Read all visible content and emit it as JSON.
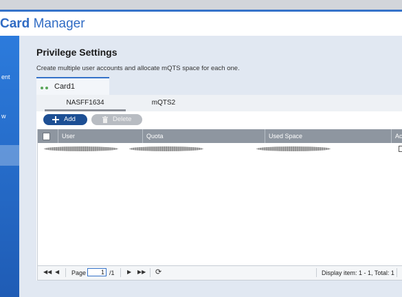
{
  "app": {
    "title_bold": "Card",
    "title_rest": " Manager"
  },
  "sidebar": {
    "items": [
      {
        "label": "ent"
      },
      {
        "label": "w"
      }
    ]
  },
  "main": {
    "title": "Privilege Settings",
    "description": "Create multiple user accounts and allocate mQTS space for each one.",
    "card_tab": "Card1",
    "subtabs": [
      {
        "label": "NASFF1634",
        "active": true
      },
      {
        "label": "mQTS2",
        "active": false
      }
    ],
    "toolbar": {
      "add_label": "Add",
      "delete_label": "Delete"
    },
    "table": {
      "columns": [
        "User",
        "Quota",
        "Used Space",
        "Ac"
      ],
      "rows_count_note": 1
    },
    "pager": {
      "page_label": "Page",
      "page_value": "1",
      "page_total": "/1",
      "display_text": "Display item: 1 - 1, Total: 1"
    }
  },
  "colors": {
    "accent": "#3572c9",
    "add_button": "#1d4f94",
    "header": "#8e96a0"
  },
  "icons": [
    "plus-icon",
    "trash-icon",
    "first-page-icon",
    "prev-page-icon",
    "next-page-icon",
    "last-page-icon",
    "refresh-icon",
    "edit-icon",
    "status-dot-icon"
  ]
}
